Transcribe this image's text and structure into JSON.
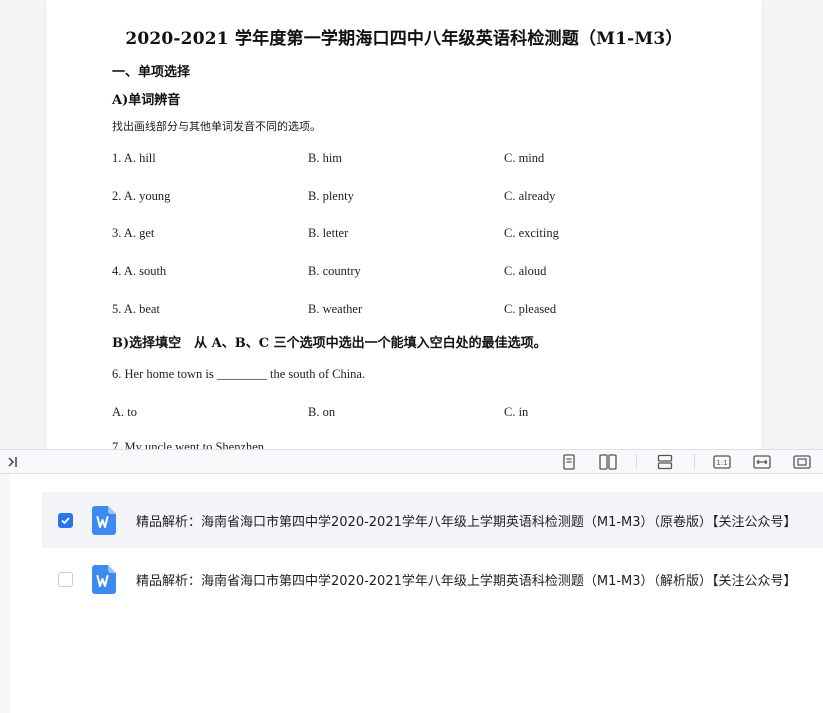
{
  "document": {
    "title": "2020-2021 学年度第一学期海口四中八年级英语科检测题（M1-M3）",
    "section1": "一、单项选择",
    "sectionA": "A)单词辨音",
    "instruction": "找出画线部分与其他单词发音不同的选项。",
    "questions": [
      {
        "a": "1. A. hill",
        "b": "B. him",
        "c": "C. mind"
      },
      {
        "a": "2. A. young",
        "b": "B. plenty",
        "c": "C. already"
      },
      {
        "a": "3. A. get",
        "b": "B. letter",
        "c": "C. exciting"
      },
      {
        "a": "4. A. south",
        "b": "B. country",
        "c": "C. aloud"
      },
      {
        "a": "5. A. beat",
        "b": "B. weather",
        "c": "C. pleased"
      }
    ],
    "sectionB": "B)选择填空　从 A、B、C 三个选项中选出一个能填入空白处的最佳选项。",
    "q6_text": "6. Her home town is ________ the south of China.",
    "q6_options": {
      "a": "A. to",
      "b": "B. on",
      "c": "C. in"
    },
    "q7_partial": "7. My uncle went to Shenzhen"
  },
  "toolbar": {
    "collapse_icon": "collapse-panel-icon",
    "icons": [
      "single-page-icon",
      "two-page-icon",
      "continuous-scroll-icon",
      "actual-size-icon",
      "fit-width-icon",
      "fit-page-icon"
    ]
  },
  "files": [
    {
      "checked": true,
      "name": "精品解析：海南省海口市第四中学2020-2021学年八年级上学期英语科检测题（M1-M3）（原卷版）【关注公众号】"
    },
    {
      "checked": false,
      "name": "精品解析：海南省海口市第四中学2020-2021学年八年级上学期英语科检测题（M1-M3）（解析版）【关注公众号】"
    }
  ],
  "colors": {
    "accent": "#2a73e8",
    "word_icon": "#3d8bf0"
  }
}
